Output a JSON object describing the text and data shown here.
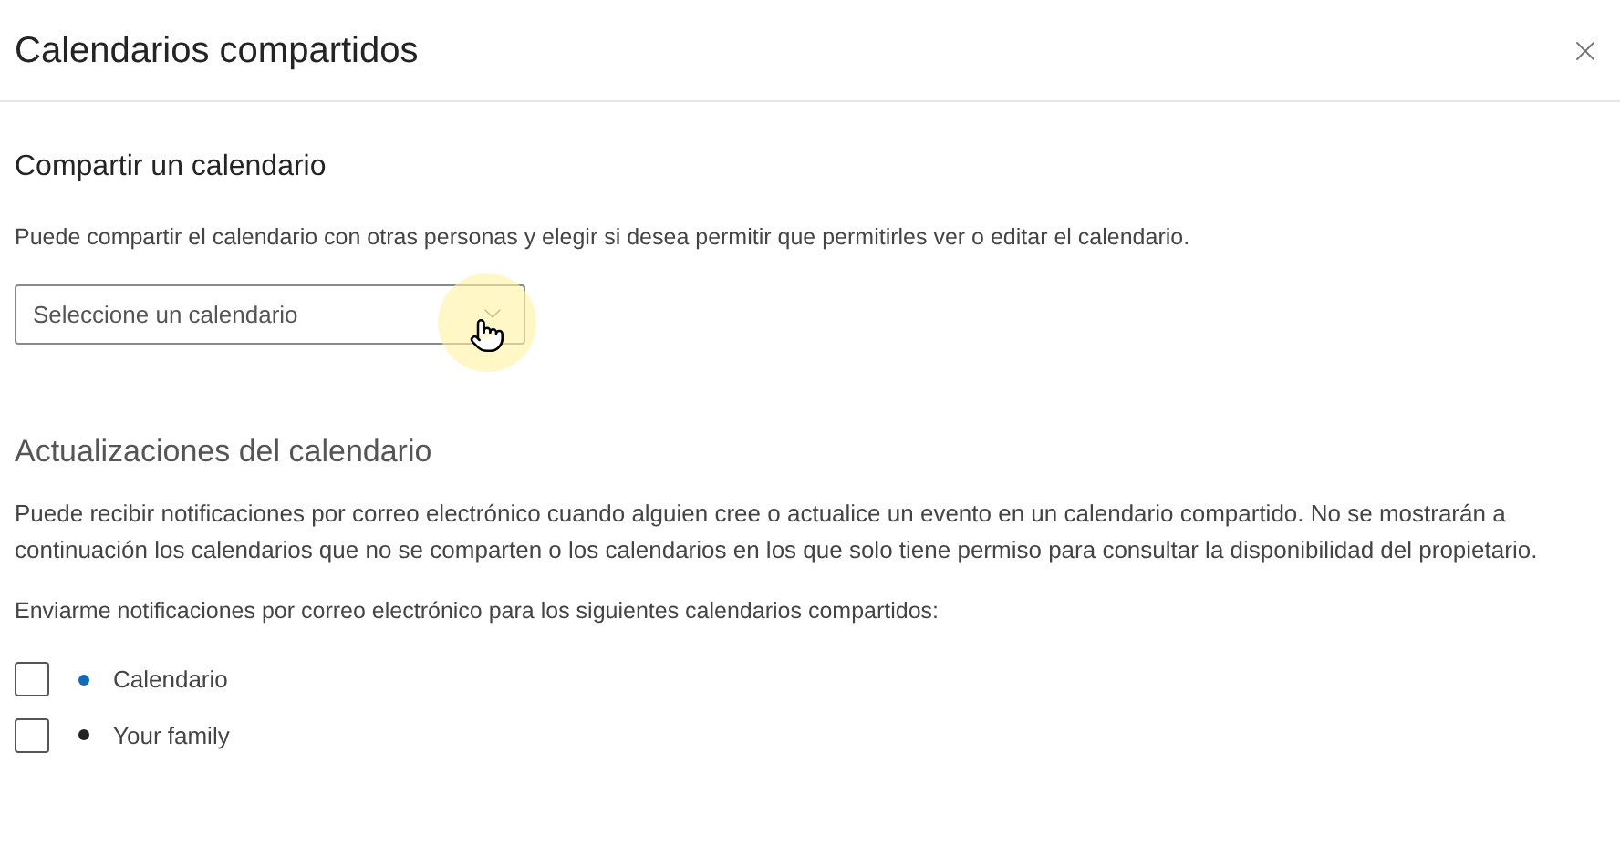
{
  "dialog": {
    "title": "Calendarios compartidos"
  },
  "share": {
    "heading": "Compartir un calendario",
    "description": "Puede compartir el calendario con otras personas y elegir si desea permitir que permitirles ver o editar el calendario.",
    "select": {
      "placeholder": "Seleccione un calendario"
    }
  },
  "updates": {
    "heading": "Actualizaciones del calendario",
    "description": "Puede recibir notificaciones por correo electrónico cuando alguien cree o actualice un evento en un calendario compartido. No se mostrarán a continuación los calendarios que no se comparten o los calendarios en los que solo tiene permiso para consultar la disponibilidad del propietario.",
    "prompt": "Enviarme notificaciones por correo electrónico para los siguientes calendarios compartidos:",
    "calendars": [
      {
        "label": "Calendario",
        "checked": false,
        "color": "#0f6cbd"
      },
      {
        "label": "Your family",
        "checked": false,
        "color": "#242424"
      }
    ]
  }
}
